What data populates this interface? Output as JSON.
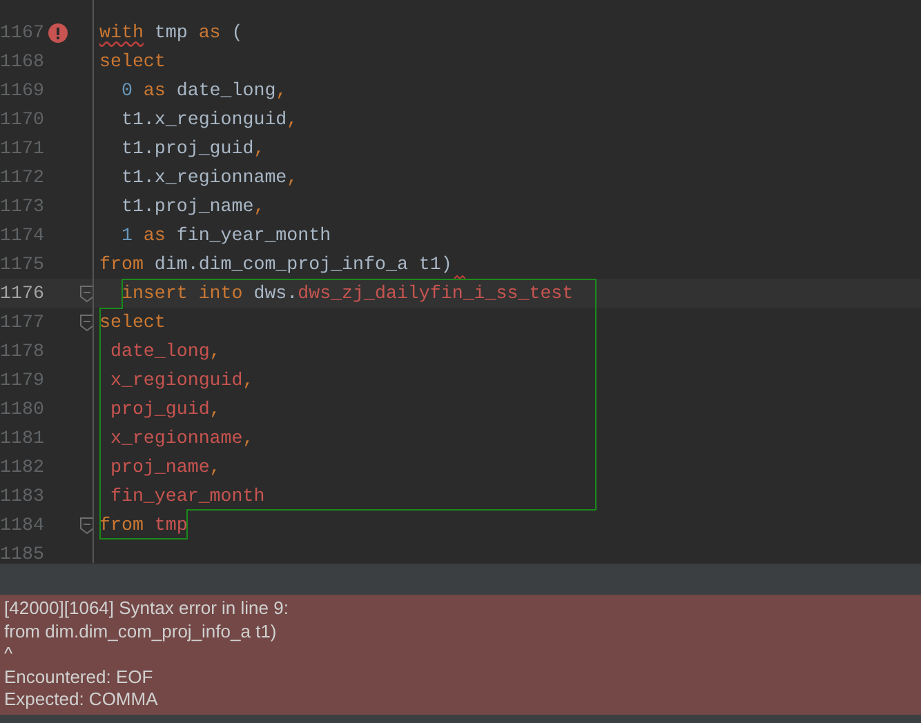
{
  "editor": {
    "lines": [
      {
        "number": "1167",
        "error": true,
        "tokens": [
          {
            "kind": "keyword",
            "text": "with",
            "underlined": true
          },
          {
            "kind": "ident",
            "text": " tmp "
          },
          {
            "kind": "keyword",
            "text": "as"
          },
          {
            "kind": "ident",
            "text": " ("
          }
        ]
      },
      {
        "number": "1168",
        "tokens": [
          {
            "kind": "keyword",
            "text": "select"
          }
        ]
      },
      {
        "number": "1169",
        "tokens": [
          {
            "kind": "number",
            "text": "  0 "
          },
          {
            "kind": "keyword",
            "text": "as"
          },
          {
            "kind": "ident",
            "text": " date_long"
          },
          {
            "kind": "keyword",
            "text": ","
          }
        ]
      },
      {
        "number": "1170",
        "tokens": [
          {
            "kind": "ident",
            "text": "  t1.x_regionguid"
          },
          {
            "kind": "keyword",
            "text": ","
          }
        ]
      },
      {
        "number": "1171",
        "tokens": [
          {
            "kind": "ident",
            "text": "  t1.proj_guid"
          },
          {
            "kind": "keyword",
            "text": ","
          }
        ]
      },
      {
        "number": "1172",
        "tokens": [
          {
            "kind": "ident",
            "text": "  t1.x_regionname"
          },
          {
            "kind": "keyword",
            "text": ","
          }
        ]
      },
      {
        "number": "1173",
        "tokens": [
          {
            "kind": "ident",
            "text": "  t1.proj_name"
          },
          {
            "kind": "keyword",
            "text": ","
          }
        ]
      },
      {
        "number": "1174",
        "tokens": [
          {
            "kind": "number",
            "text": "  1 "
          },
          {
            "kind": "keyword",
            "text": "as"
          },
          {
            "kind": "ident",
            "text": " fin_year_month"
          }
        ]
      },
      {
        "number": "1175",
        "trailing_squiggle": true,
        "tokens": [
          {
            "kind": "keyword",
            "text": "from"
          },
          {
            "kind": "ident",
            "text": " dim.dim_com_proj_info_a t1)"
          }
        ]
      },
      {
        "number": "1176",
        "current": true,
        "fold": true,
        "tokens": [
          {
            "kind": "keyword",
            "text": "  insert into"
          },
          {
            "kind": "ident",
            "text": " dws."
          },
          {
            "kind": "unresolved",
            "text": "dws_zj_dailyfin_i_ss_test"
          }
        ]
      },
      {
        "number": "1177",
        "fold": true,
        "tokens": [
          {
            "kind": "keyword",
            "text": "select"
          }
        ]
      },
      {
        "number": "1178",
        "tokens": [
          {
            "kind": "unresolved",
            "text": " date_long"
          },
          {
            "kind": "keyword",
            "text": ","
          }
        ]
      },
      {
        "number": "1179",
        "tokens": [
          {
            "kind": "unresolved",
            "text": " x_regionguid"
          },
          {
            "kind": "keyword",
            "text": ","
          }
        ]
      },
      {
        "number": "1180",
        "tokens": [
          {
            "kind": "unresolved",
            "text": " proj_guid"
          },
          {
            "kind": "keyword",
            "text": ","
          }
        ]
      },
      {
        "number": "1181",
        "tokens": [
          {
            "kind": "unresolved",
            "text": " x_regionname"
          },
          {
            "kind": "keyword",
            "text": ","
          }
        ]
      },
      {
        "number": "1182",
        "tokens": [
          {
            "kind": "unresolved",
            "text": " proj_name"
          },
          {
            "kind": "keyword",
            "text": ","
          }
        ]
      },
      {
        "number": "1183",
        "tokens": [
          {
            "kind": "unresolved",
            "text": " fin_year_month"
          }
        ]
      },
      {
        "number": "1184",
        "fold": true,
        "tokens": [
          {
            "kind": "keyword",
            "text": "from"
          },
          {
            "kind": "unresolved",
            "text": " tmp"
          }
        ]
      },
      {
        "number": "1185"
      }
    ]
  },
  "error_panel": {
    "lines": [
      "[42000][1064] Syntax error in line 9:",
      "from dim.dim_com_proj_info_a t1)",
      "^",
      "Encountered: EOF",
      "Expected: COMMA"
    ]
  }
}
